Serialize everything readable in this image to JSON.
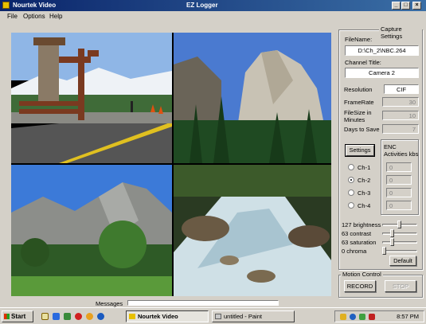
{
  "window": {
    "app_name": "Nourtek Video",
    "title": "EZ Logger",
    "min_glyph": "_",
    "max_glyph": "□",
    "close_glyph": "×"
  },
  "menu": {
    "file": "File",
    "options": "Options",
    "help": "Help"
  },
  "capture": {
    "group_label": "Capture Settings",
    "filename_label": "FileName:",
    "filename_value": "D:\\Ch_2\\NBC.264",
    "channel_title_label": "Channel Title:",
    "channel_title_value": "Camera 2",
    "resolution_label": "Resolution",
    "resolution_value": "CIF",
    "framerate_label": "FrameRate",
    "framerate_value": "30",
    "filesize_label_1": "FileSize in",
    "filesize_label_2": "Minutes",
    "filesize_value": "10",
    "days_label": "Days to Save",
    "days_value": "7",
    "settings_button": "Settings",
    "enc_label_1": "ENC",
    "enc_label_2": "Activities kbs",
    "channels": [
      {
        "label": "Ch-1",
        "value": "0",
        "selected": false
      },
      {
        "label": "Ch-2",
        "value": "0",
        "selected": true
      },
      {
        "label": "Ch-3",
        "value": "0",
        "selected": false
      },
      {
        "label": "Ch-4",
        "value": "0",
        "selected": false
      }
    ],
    "adjustments": [
      {
        "label": "127 brightness",
        "level": 127
      },
      {
        "label": "63 contrast",
        "level": 63
      },
      {
        "label": "63 saturation",
        "level": 63
      },
      {
        "label": "0 chroma",
        "level": 0
      }
    ],
    "default_button": "Default"
  },
  "motion": {
    "group_label": "Motion Control",
    "record_button": "RECORD",
    "stop_button": "STOP"
  },
  "messages_label": "Messages",
  "taskbar": {
    "start": "Start",
    "tasks": [
      {
        "label": "Nourtek Video",
        "active": true
      },
      {
        "label": "untitled - Paint",
        "active": false
      }
    ],
    "clock": "8:57 PM"
  },
  "colors": {
    "title_gradient_start": "#0a246a",
    "title_gradient_end": "#3a6ea5",
    "face": "#d4d0c8"
  }
}
